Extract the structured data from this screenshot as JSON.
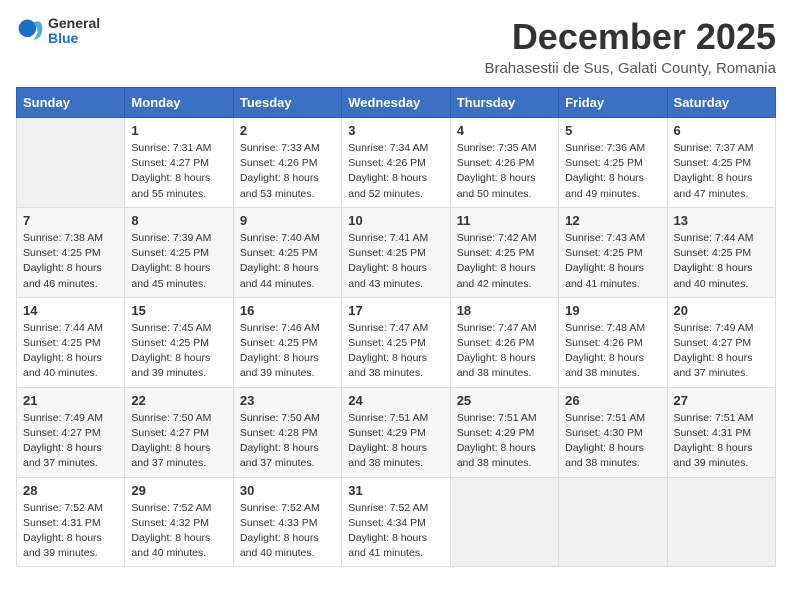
{
  "header": {
    "logo_general": "General",
    "logo_blue": "Blue",
    "month_year": "December 2025",
    "location": "Brahasestii de Sus, Galati County, Romania"
  },
  "weekdays": [
    "Sunday",
    "Monday",
    "Tuesday",
    "Wednesday",
    "Thursday",
    "Friday",
    "Saturday"
  ],
  "weeks": [
    [
      {
        "day": "",
        "info": ""
      },
      {
        "day": "1",
        "info": "Sunrise: 7:31 AM\nSunset: 4:27 PM\nDaylight: 8 hours\nand 55 minutes."
      },
      {
        "day": "2",
        "info": "Sunrise: 7:33 AM\nSunset: 4:26 PM\nDaylight: 8 hours\nand 53 minutes."
      },
      {
        "day": "3",
        "info": "Sunrise: 7:34 AM\nSunset: 4:26 PM\nDaylight: 8 hours\nand 52 minutes."
      },
      {
        "day": "4",
        "info": "Sunrise: 7:35 AM\nSunset: 4:26 PM\nDaylight: 8 hours\nand 50 minutes."
      },
      {
        "day": "5",
        "info": "Sunrise: 7:36 AM\nSunset: 4:25 PM\nDaylight: 8 hours\nand 49 minutes."
      },
      {
        "day": "6",
        "info": "Sunrise: 7:37 AM\nSunset: 4:25 PM\nDaylight: 8 hours\nand 47 minutes."
      }
    ],
    [
      {
        "day": "7",
        "info": "Sunrise: 7:38 AM\nSunset: 4:25 PM\nDaylight: 8 hours\nand 46 minutes."
      },
      {
        "day": "8",
        "info": "Sunrise: 7:39 AM\nSunset: 4:25 PM\nDaylight: 8 hours\nand 45 minutes."
      },
      {
        "day": "9",
        "info": "Sunrise: 7:40 AM\nSunset: 4:25 PM\nDaylight: 8 hours\nand 44 minutes."
      },
      {
        "day": "10",
        "info": "Sunrise: 7:41 AM\nSunset: 4:25 PM\nDaylight: 8 hours\nand 43 minutes."
      },
      {
        "day": "11",
        "info": "Sunrise: 7:42 AM\nSunset: 4:25 PM\nDaylight: 8 hours\nand 42 minutes."
      },
      {
        "day": "12",
        "info": "Sunrise: 7:43 AM\nSunset: 4:25 PM\nDaylight: 8 hours\nand 41 minutes."
      },
      {
        "day": "13",
        "info": "Sunrise: 7:44 AM\nSunset: 4:25 PM\nDaylight: 8 hours\nand 40 minutes."
      }
    ],
    [
      {
        "day": "14",
        "info": "Sunrise: 7:44 AM\nSunset: 4:25 PM\nDaylight: 8 hours\nand 40 minutes."
      },
      {
        "day": "15",
        "info": "Sunrise: 7:45 AM\nSunset: 4:25 PM\nDaylight: 8 hours\nand 39 minutes."
      },
      {
        "day": "16",
        "info": "Sunrise: 7:46 AM\nSunset: 4:25 PM\nDaylight: 8 hours\nand 39 minutes."
      },
      {
        "day": "17",
        "info": "Sunrise: 7:47 AM\nSunset: 4:25 PM\nDaylight: 8 hours\nand 38 minutes."
      },
      {
        "day": "18",
        "info": "Sunrise: 7:47 AM\nSunset: 4:26 PM\nDaylight: 8 hours\nand 38 minutes."
      },
      {
        "day": "19",
        "info": "Sunrise: 7:48 AM\nSunset: 4:26 PM\nDaylight: 8 hours\nand 38 minutes."
      },
      {
        "day": "20",
        "info": "Sunrise: 7:49 AM\nSunset: 4:27 PM\nDaylight: 8 hours\nand 37 minutes."
      }
    ],
    [
      {
        "day": "21",
        "info": "Sunrise: 7:49 AM\nSunset: 4:27 PM\nDaylight: 8 hours\nand 37 minutes."
      },
      {
        "day": "22",
        "info": "Sunrise: 7:50 AM\nSunset: 4:27 PM\nDaylight: 8 hours\nand 37 minutes."
      },
      {
        "day": "23",
        "info": "Sunrise: 7:50 AM\nSunset: 4:28 PM\nDaylight: 8 hours\nand 37 minutes."
      },
      {
        "day": "24",
        "info": "Sunrise: 7:51 AM\nSunset: 4:29 PM\nDaylight: 8 hours\nand 38 minutes."
      },
      {
        "day": "25",
        "info": "Sunrise: 7:51 AM\nSunset: 4:29 PM\nDaylight: 8 hours\nand 38 minutes."
      },
      {
        "day": "26",
        "info": "Sunrise: 7:51 AM\nSunset: 4:30 PM\nDaylight: 8 hours\nand 38 minutes."
      },
      {
        "day": "27",
        "info": "Sunrise: 7:51 AM\nSunset: 4:31 PM\nDaylight: 8 hours\nand 39 minutes."
      }
    ],
    [
      {
        "day": "28",
        "info": "Sunrise: 7:52 AM\nSunset: 4:31 PM\nDaylight: 8 hours\nand 39 minutes."
      },
      {
        "day": "29",
        "info": "Sunrise: 7:52 AM\nSunset: 4:32 PM\nDaylight: 8 hours\nand 40 minutes."
      },
      {
        "day": "30",
        "info": "Sunrise: 7:52 AM\nSunset: 4:33 PM\nDaylight: 8 hours\nand 40 minutes."
      },
      {
        "day": "31",
        "info": "Sunrise: 7:52 AM\nSunset: 4:34 PM\nDaylight: 8 hours\nand 41 minutes."
      },
      {
        "day": "",
        "info": ""
      },
      {
        "day": "",
        "info": ""
      },
      {
        "day": "",
        "info": ""
      }
    ]
  ]
}
